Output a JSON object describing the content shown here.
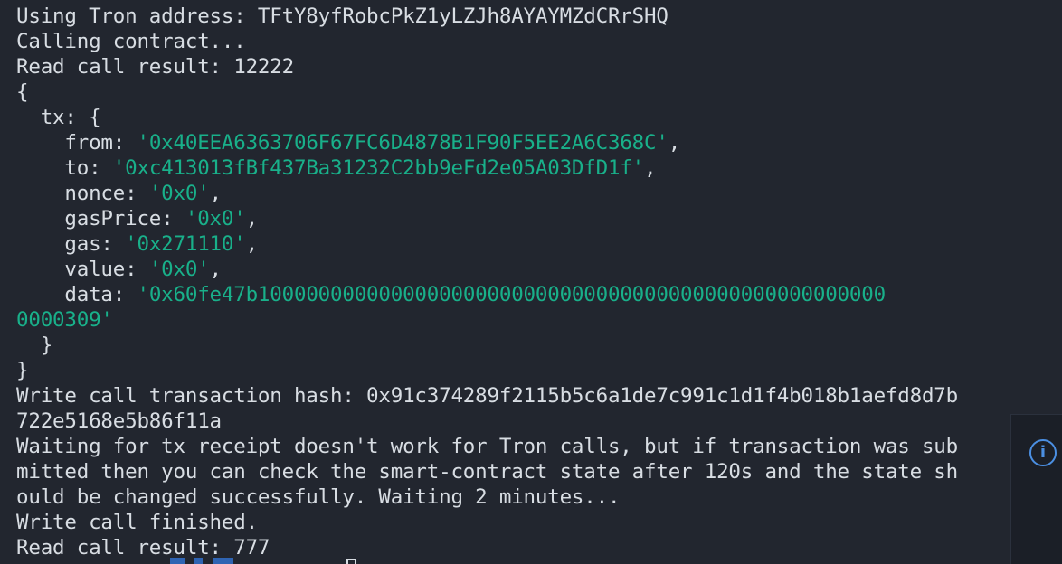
{
  "terminal": {
    "lines": [
      [
        {
          "t": "Using Tron address: TFtY8yfRobcPkZ1yLZJh8AYAYMZdCRrSHQ"
        }
      ],
      [
        {
          "t": "Calling contract..."
        }
      ],
      [
        {
          "t": "Read call result: 12222"
        }
      ],
      [
        {
          "t": "{"
        }
      ],
      [
        {
          "t": "  tx: {"
        }
      ],
      [
        {
          "t": "    from: "
        },
        {
          "t": "'0x40EEA6363706F67FC6D4878B1F90F5EE2A6C368C'",
          "s": true
        },
        {
          "t": ","
        }
      ],
      [
        {
          "t": "    to: "
        },
        {
          "t": "'0xc413013fBf437Ba31232C2bb9eFd2e05A03DfD1f'",
          "s": true
        },
        {
          "t": ","
        }
      ],
      [
        {
          "t": "    nonce: "
        },
        {
          "t": "'0x0'",
          "s": true
        },
        {
          "t": ","
        }
      ],
      [
        {
          "t": "    gasPrice: "
        },
        {
          "t": "'0x0'",
          "s": true
        },
        {
          "t": ","
        }
      ],
      [
        {
          "t": "    gas: "
        },
        {
          "t": "'0x271110'",
          "s": true
        },
        {
          "t": ","
        }
      ],
      [
        {
          "t": "    value: "
        },
        {
          "t": "'0x0'",
          "s": true
        },
        {
          "t": ","
        }
      ],
      [
        {
          "t": "    data: "
        },
        {
          "t": "'0x60fe47b1000000000000000000000000000000000000000000000000000",
          "s": true
        }
      ],
      [
        {
          "t": "0000309'",
          "s": true
        }
      ],
      [
        {
          "t": "  }"
        }
      ],
      [
        {
          "t": "}"
        }
      ],
      [
        {
          "t": "Write call transaction hash: 0x91c374289f2115b5c6a1de7c991c1d1f4b018b1aefd8d7b"
        }
      ],
      [
        {
          "t": "722e5168e5b86f11a"
        }
      ],
      [
        {
          "t": "Waiting for tx receipt doesn't work for Tron calls, but if transaction was sub"
        }
      ],
      [
        {
          "t": "mitted then you can check the smart-contract state after 120s and the state sh"
        }
      ],
      [
        {
          "t": "ould be changed successfully. Waiting 2 minutes..."
        }
      ],
      [
        {
          "t": "Write call finished."
        }
      ],
      [
        {
          "t": "Read call result: 777"
        }
      ]
    ]
  },
  "side_panel": {
    "icon": "info-icon",
    "glyph": "i"
  },
  "colors": {
    "background": "#22262f",
    "text": "#d8dde3",
    "string": "#19b08a",
    "info": "#4b8fe2"
  }
}
